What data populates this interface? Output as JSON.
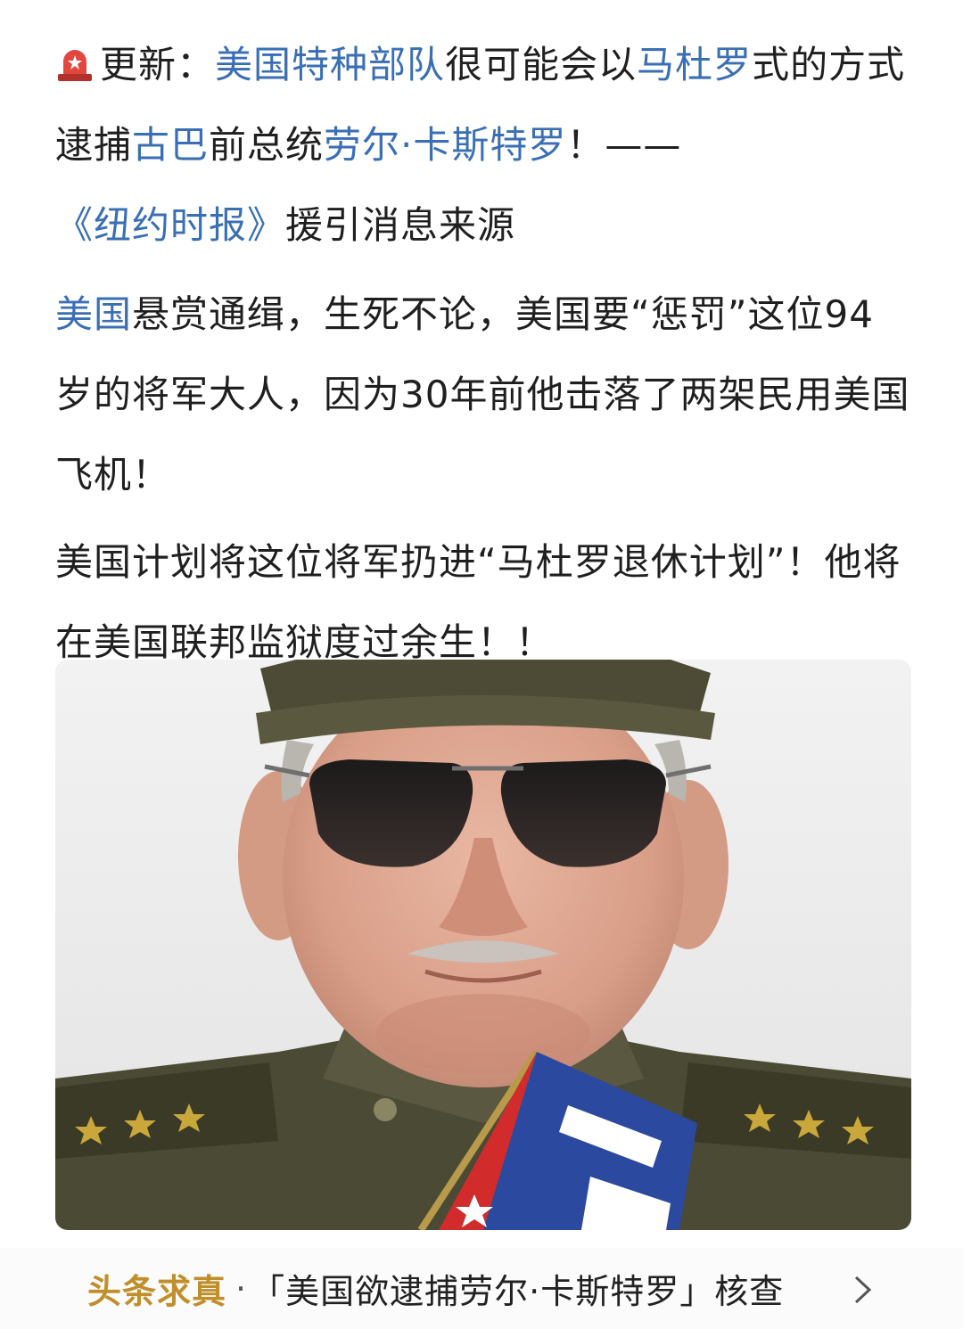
{
  "article": {
    "p1": {
      "prefix": "更新：",
      "l1": "美国特种部队",
      "t1": "很可能会以",
      "l2": "马杜罗",
      "t2": "式的方式逮捕",
      "l3": "古巴",
      "t3": "前总统",
      "l4": "劳尔·卡斯特罗",
      "t4": "！——",
      "l5": "《纽约时报》",
      "t5": "援引消息来源"
    },
    "p2": {
      "l1": "美国",
      "t1": "悬赏通缉，生死不论，美国要“惩罚”这位94岁的将军大人，因为30年前他击落了两架民用美国飞机！"
    },
    "p3": {
      "t1": "美国计划将这位将军扔进“马杜罗退休计划”！他将在美国联邦监狱度过余生！！"
    }
  },
  "source_bar": {
    "brand": "头条求真",
    "dot": "·",
    "title": "「美国欲逮捕劳尔·卡斯特罗」核查"
  },
  "colors": {
    "link": "#3a6fb5",
    "brand": "#c08f2c",
    "text": "#1f1f1f"
  },
  "icons": [
    "alarm-light-icon",
    "chevron-right-icon"
  ]
}
